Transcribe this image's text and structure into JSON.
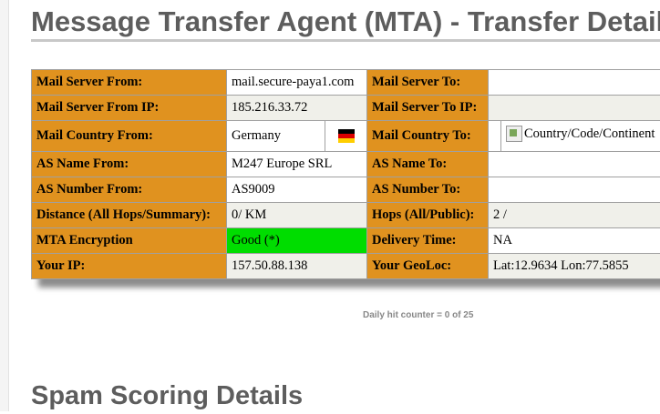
{
  "page": {
    "title": "Message Transfer Agent (MTA) - Transfer Details",
    "section2_title": "Spam Scoring Details",
    "counter_text": "Daily hit counter = 0 of 25"
  },
  "table": {
    "server_from_label": "Mail Server From:",
    "server_from_value": "mail.secure-paya1.com",
    "server_to_label": "Mail Server To:",
    "server_to_value": "",
    "server_from_ip_label": "Mail Server From IP:",
    "server_from_ip_value": "185.216.33.72",
    "server_to_ip_label": "Mail Server To IP:",
    "server_to_ip_value": "",
    "country_from_label": "Mail Country From:",
    "country_from_value": "Germany",
    "country_from_flag": "germany-flag-icon",
    "country_to_label": "Mail Country To:",
    "country_to_value": "Country/Code/Continent",
    "as_name_from_label": "AS Name From:",
    "as_name_from_value": "M247 Europe SRL",
    "as_name_to_label": "AS Name To:",
    "as_name_to_value": "",
    "as_number_from_label": "AS Number From:",
    "as_number_from_value": "AS9009",
    "as_number_to_label": "AS Number To:",
    "as_number_to_value": "",
    "distance_label": "Distance (All Hops/Summary):",
    "distance_value": "0/ KM",
    "hops_label": "Hops (All/Public):",
    "hops_value": "2 /",
    "encryption_label": "MTA Encryption",
    "encryption_value": "Good (*)",
    "delivery_label": "Delivery Time:",
    "delivery_value": "NA",
    "your_ip_label": "Your IP:",
    "your_ip_value": "157.50.88.138",
    "geoloc_label": "Your GeoLoc:",
    "geoloc_value": "Lat:12.9634 Lon:77.5855"
  },
  "colors": {
    "label_bg": "#e0921f",
    "good_bg": "#00dd00",
    "heading": "#5d5d5d"
  }
}
